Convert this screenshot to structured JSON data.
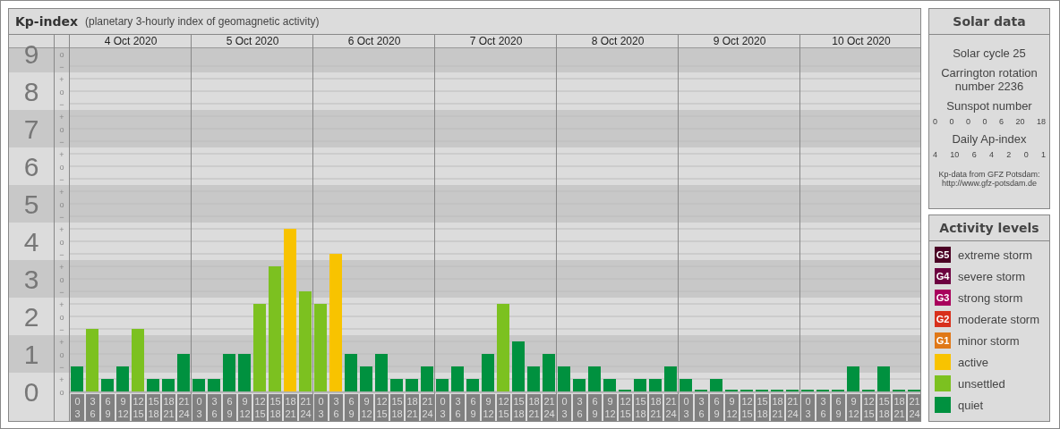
{
  "main": {
    "title": "Kp-index",
    "subtitle": "(planetary 3-hourly index of geomagnetic activity)",
    "kp_marks": [
      "o",
      "−",
      "+",
      "o",
      "−",
      "+",
      "o",
      "−",
      "+",
      "o",
      "−",
      "+",
      "o",
      "−",
      "+",
      "o",
      "−",
      "+",
      "o",
      "−",
      "+",
      "o",
      "−",
      "+",
      "o",
      "−",
      "+",
      "o"
    ],
    "days": [
      {
        "date": "4 Oct 2020",
        "slots": [
          [
            "0",
            "3"
          ],
          [
            "3",
            "6"
          ],
          [
            "6",
            "9"
          ],
          [
            "9",
            "12"
          ],
          [
            "12",
            "15"
          ],
          [
            "15",
            "18"
          ],
          [
            "18",
            "21"
          ],
          [
            "21",
            "24"
          ]
        ]
      },
      {
        "date": "5 Oct 2020",
        "slots": [
          [
            "0",
            "3"
          ],
          [
            "3",
            "6"
          ],
          [
            "6",
            "9"
          ],
          [
            "9",
            "12"
          ],
          [
            "12",
            "15"
          ],
          [
            "15",
            "18"
          ],
          [
            "18",
            "21"
          ],
          [
            "21",
            "24"
          ]
        ]
      },
      {
        "date": "6 Oct 2020",
        "slots": [
          [
            "0",
            "3"
          ],
          [
            "3",
            "6"
          ],
          [
            "6",
            "9"
          ],
          [
            "9",
            "12"
          ],
          [
            "12",
            "15"
          ],
          [
            "15",
            "18"
          ],
          [
            "18",
            "21"
          ],
          [
            "21",
            "24"
          ]
        ]
      },
      {
        "date": "7 Oct 2020",
        "slots": [
          [
            "0",
            "3"
          ],
          [
            "3",
            "6"
          ],
          [
            "6",
            "9"
          ],
          [
            "9",
            "12"
          ],
          [
            "12",
            "15"
          ],
          [
            "15",
            "18"
          ],
          [
            "18",
            "21"
          ],
          [
            "21",
            "24"
          ]
        ]
      },
      {
        "date": "8 Oct 2020",
        "slots": [
          [
            "0",
            "3"
          ],
          [
            "3",
            "6"
          ],
          [
            "6",
            "9"
          ],
          [
            "9",
            "12"
          ],
          [
            "12",
            "15"
          ],
          [
            "15",
            "18"
          ],
          [
            "18",
            "21"
          ],
          [
            "21",
            "24"
          ]
        ]
      },
      {
        "date": "9 Oct 2020",
        "slots": [
          [
            "0",
            "3"
          ],
          [
            "3",
            "6"
          ],
          [
            "6",
            "9"
          ],
          [
            "9",
            "12"
          ],
          [
            "12",
            "15"
          ],
          [
            "15",
            "18"
          ],
          [
            "18",
            "21"
          ],
          [
            "21",
            "24"
          ]
        ]
      },
      {
        "date": "10 Oct 2020",
        "slots": [
          [
            "0",
            "3"
          ],
          [
            "3",
            "6"
          ],
          [
            "6",
            "9"
          ],
          [
            "9",
            "12"
          ],
          [
            "12",
            "15"
          ],
          [
            "15",
            "18"
          ],
          [
            "18",
            "21"
          ],
          [
            "21",
            "24"
          ]
        ]
      }
    ],
    "chart_data": {
      "type": "bar",
      "grid": true,
      "ylim": [
        0,
        9.5
      ],
      "yticks": [
        0,
        1,
        2,
        3,
        4,
        5,
        6,
        7,
        8,
        9
      ],
      "series": [
        {
          "values": [
            0.67,
            1.67,
            0.33,
            0.67,
            1.67,
            0.33,
            0.33,
            1,
            0.33,
            0.33,
            1,
            1,
            2.33,
            3.33,
            4.33,
            2.67,
            2.33,
            3.67,
            1,
            0.67,
            1,
            0.33,
            0.33,
            0.67,
            0.33,
            0.67,
            0.33,
            1,
            2.33,
            1.33,
            0.67,
            1,
            0.67,
            0.33,
            0.67,
            0.33,
            0,
            0.33,
            0.33,
            0.67,
            0.33,
            0,
            0.33,
            0,
            0,
            0,
            0,
            0,
            0,
            0,
            0,
            0.67,
            0,
            0.67,
            0,
            0
          ]
        }
      ]
    }
  },
  "solar_data": {
    "title": "Solar data",
    "cycle": "Solar cycle 25",
    "rotation": "Carrington rotation number 2236",
    "sunspot_label": "Sunspot number",
    "sunspots": [
      "0",
      "0",
      "0",
      "0",
      "6",
      "20",
      "18"
    ],
    "ap_label": "Daily Ap-index",
    "ap": [
      "4",
      "10",
      "6",
      "4",
      "2",
      "0",
      "1"
    ],
    "source": "Kp-data from GFZ Potsdam:",
    "source_url": "http://www.gfz-potsdam.de"
  },
  "activity_levels": {
    "title": "Activity levels",
    "items": [
      {
        "badge": "G5",
        "label": "extreme storm",
        "color": "#4a0024"
      },
      {
        "badge": "G4",
        "label": "severe storm",
        "color": "#6c0040"
      },
      {
        "badge": "G3",
        "label": "strong storm",
        "color": "#a8005c"
      },
      {
        "badge": "G2",
        "label": "moderate storm",
        "color": "#d8301c"
      },
      {
        "badge": "G1",
        "label": "minor storm",
        "color": "#e07818"
      },
      {
        "label": "active",
        "color": "#f8c300"
      },
      {
        "label": "unsettled",
        "color": "#7cc120"
      },
      {
        "label": "quiet",
        "color": "#00913f"
      }
    ]
  }
}
